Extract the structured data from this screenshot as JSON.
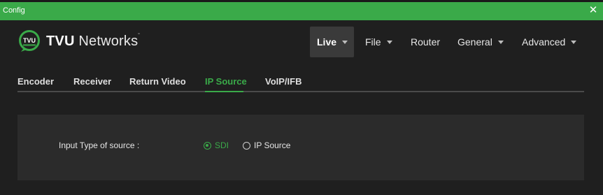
{
  "window": {
    "title": "Config",
    "close_glyph": "✕"
  },
  "logo": {
    "icon": "tvu-logo-icon",
    "brand_bold": "TVU",
    "brand_rest": " Networks",
    "trademark": "˜"
  },
  "nav": {
    "items": [
      {
        "label": "Live",
        "has_dropdown": true,
        "active": true
      },
      {
        "label": "File",
        "has_dropdown": true,
        "active": false
      },
      {
        "label": "Router",
        "has_dropdown": false,
        "active": false
      },
      {
        "label": "General",
        "has_dropdown": true,
        "active": false
      },
      {
        "label": "Advanced",
        "has_dropdown": true,
        "active": false
      }
    ]
  },
  "tabs": {
    "items": [
      "Encoder",
      "Receiver",
      "Return Video",
      "IP Source",
      "VoIP/IFB"
    ],
    "active": "IP Source"
  },
  "form": {
    "input_type_label": "Input Type of source :",
    "options": [
      {
        "label": "SDI",
        "selected": true
      },
      {
        "label": "IP Source",
        "selected": false
      }
    ]
  },
  "colors": {
    "accent": "#3aaa49",
    "background": "#1f1f1f",
    "panel": "#2b2b2b"
  }
}
